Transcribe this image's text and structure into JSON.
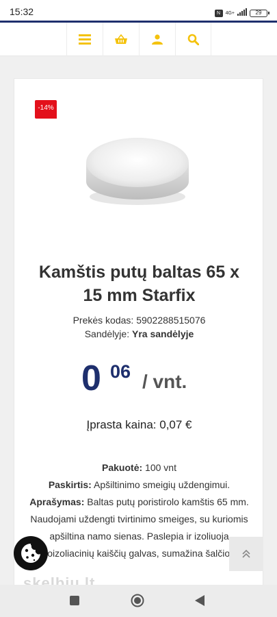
{
  "status_bar": {
    "time": "15:32",
    "network": "4G+",
    "battery": "29",
    "icons": [
      "nfc-icon",
      "signal-icon",
      "battery-icon"
    ]
  },
  "header": {
    "icons": [
      "menu-icon",
      "basket-icon",
      "user-icon",
      "search-icon"
    ],
    "accent_color": "#f4c20d",
    "brand_color": "#1e2f6d"
  },
  "product": {
    "discount_badge": "-14%",
    "title": "Kamštis putų baltas 65 x 15 mm Starfix",
    "code_label": "Prekės kodas:",
    "code_value": "5902288515076",
    "stock_label": "Sandėlyje:",
    "stock_value": "Yra sandėlyje",
    "price_integer": "0",
    "price_decimal": "06",
    "price_unit": "/ vnt.",
    "regular_price": "Įprasta kaina: 0,07 €",
    "package_label": "Pakuotė:",
    "package_value": "100 vnt",
    "purpose_label": "Paskirtis:",
    "purpose_value": "Apšiltinimo smeigių uždengimui.",
    "description_label": "Aprašymas:",
    "description_value": "Baltas putų poristirolo kamštis 65 mm. Naudojami uždengti tvirtinimo smeiges, su kuriomis apšiltina namo sienas. Paslepia ir izoliuoja termoizoliacinių kaiščių galvas, sumažina šalčio tiltą.",
    "discount_color": "#e3101b"
  },
  "watermark": "skelbiu.lt",
  "floating": {
    "cookie_icon": "cookie-icon",
    "scroll_icon": "double-chevron-up-icon"
  },
  "system_nav": [
    "recents-icon",
    "home-icon",
    "back-icon"
  ]
}
